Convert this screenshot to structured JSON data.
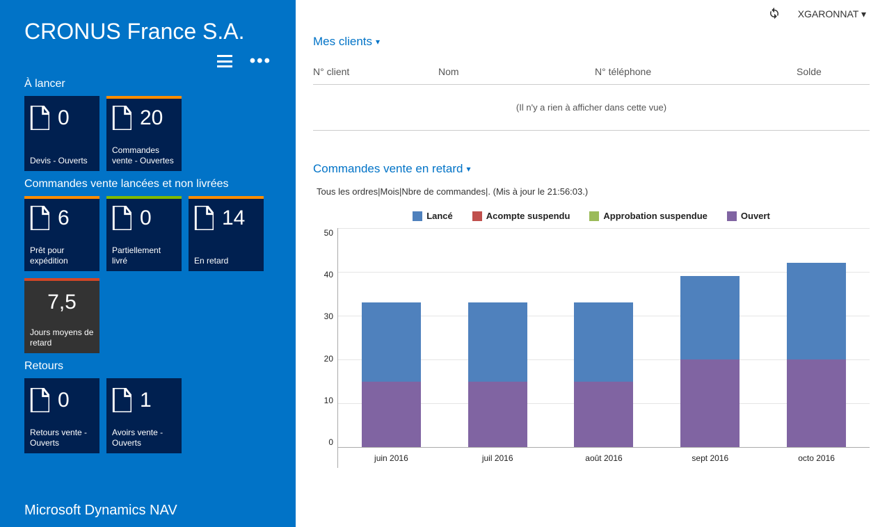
{
  "company": "CRONUS France S.A.",
  "footer_brand": "Microsoft Dynamics NAV",
  "user": {
    "name": "XGARONNAT",
    "caret": "▾"
  },
  "sidebar": {
    "sections": {
      "to_launch": {
        "title": "À lancer",
        "tiles": [
          {
            "value": "0",
            "label": "Devis - Ouverts"
          },
          {
            "value": "20",
            "label": "Commandes vente - Ouvertes"
          }
        ]
      },
      "launched": {
        "title": "Commandes vente lancées et non livrées",
        "tiles": [
          {
            "value": "6",
            "label": "Prêt pour expédition"
          },
          {
            "value": "0",
            "label": "Partiellement livré"
          },
          {
            "value": "14",
            "label": "En retard"
          },
          {
            "value": "7,5",
            "label": "Jours moyens de retard"
          }
        ]
      },
      "returns": {
        "title": "Retours",
        "tiles": [
          {
            "value": "0",
            "label": "Retours vente - Ouverts"
          },
          {
            "value": "1",
            "label": "Avoirs vente - Ouverts"
          }
        ]
      }
    }
  },
  "clients": {
    "title": "Mes clients",
    "columns": {
      "nclient": "N° client",
      "nom": "Nom",
      "tel": "N° téléphone",
      "solde": "Solde"
    },
    "empty": "(Il n'y a rien à afficher dans cette vue)"
  },
  "orders": {
    "title": "Commandes vente en retard",
    "caption": "Tous les ordres|Mois|Nbre de commandes|. (Mis à jour le 21:56:03.)",
    "legend": {
      "lance": "Lancé",
      "acompte": "Acompte suspendu",
      "approb": "Approbation suspendue",
      "ouvert": "Ouvert"
    }
  },
  "chart_data": {
    "type": "bar",
    "stacked": true,
    "categories": [
      "juin 2016",
      "juil 2016",
      "août 2016",
      "sept 2016",
      "octo 2016"
    ],
    "series": [
      {
        "name": "Ouvert",
        "color": "#8064A2",
        "values": [
          15,
          15,
          15,
          20,
          20
        ]
      },
      {
        "name": "Lancé",
        "color": "#4F81BD",
        "values": [
          18,
          18,
          18,
          19,
          22
        ]
      },
      {
        "name": "Acompte suspendu",
        "color": "#C0504D",
        "values": [
          0,
          0,
          0,
          0,
          0
        ]
      },
      {
        "name": "Approbation suspendue",
        "color": "#9BBB59",
        "values": [
          0,
          0,
          0,
          0,
          0
        ]
      }
    ],
    "y_ticks": [
      50,
      40,
      30,
      20,
      10,
      0
    ],
    "ylim": [
      0,
      50
    ],
    "xlabel": "",
    "ylabel": ""
  }
}
